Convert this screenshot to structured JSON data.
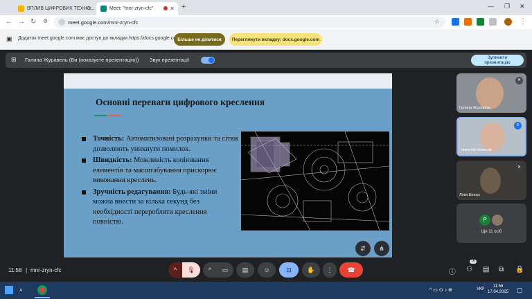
{
  "tabs": [
    {
      "title": "ВПЛИВ ЦИФРОВИХ ТЕХНО...",
      "favicon_color": "#f4b400"
    },
    {
      "title": "Meet: \"mnr-zryn-cfc\"",
      "favicon_color": "#00897b"
    }
  ],
  "address": {
    "url": "meet.google.com/mnr-zryn-cfc"
  },
  "share_bar": {
    "message": "Додаток meet.google.com має доступ до вкладки https://docs.google.com",
    "stop_share_label": "Більше не ділитися",
    "view_tab_label": "Переглянути вкладку: docs.google.com"
  },
  "presentation_bar": {
    "presenter": "Галина Журавель (Ви (показуєте презентацію))",
    "audio_label": "Звук презентації",
    "stop_label_1": "Зупинити",
    "stop_label_2": "презентацію"
  },
  "slide": {
    "title": "Основні переваги цифрового креслення",
    "bullets": [
      {
        "bold": "Точність:",
        "text": " Автоматизовані розрахунки та сітки дозволяють уникнути помилок."
      },
      {
        "bold": "Швидкість:",
        "text": " Можливість копіювання елементів та масштабування прискорює виконання креслень."
      },
      {
        "bold": "Зручність редагування:",
        "text": " Будь-які зміни можна внести за кілька секунд без необхідності переробляти креслення повністю."
      }
    ],
    "accent_colors": [
      "#1f8a70",
      "#e2643a"
    ]
  },
  "participants": [
    {
      "name": "Галина Журавель"
    },
    {
      "name": "Николай Невесов"
    },
    {
      "name": "Лілія Білоус"
    }
  ],
  "more_tile": {
    "label": "Ще 11 осіб",
    "avatar_letter": "P"
  },
  "bottom": {
    "time": "11:58",
    "meeting_code": "mnr-zryn-cfc",
    "people_count": "15"
  },
  "taskbar": {
    "time": "11:58",
    "date": "17.04.2025",
    "lang": "УКР"
  }
}
